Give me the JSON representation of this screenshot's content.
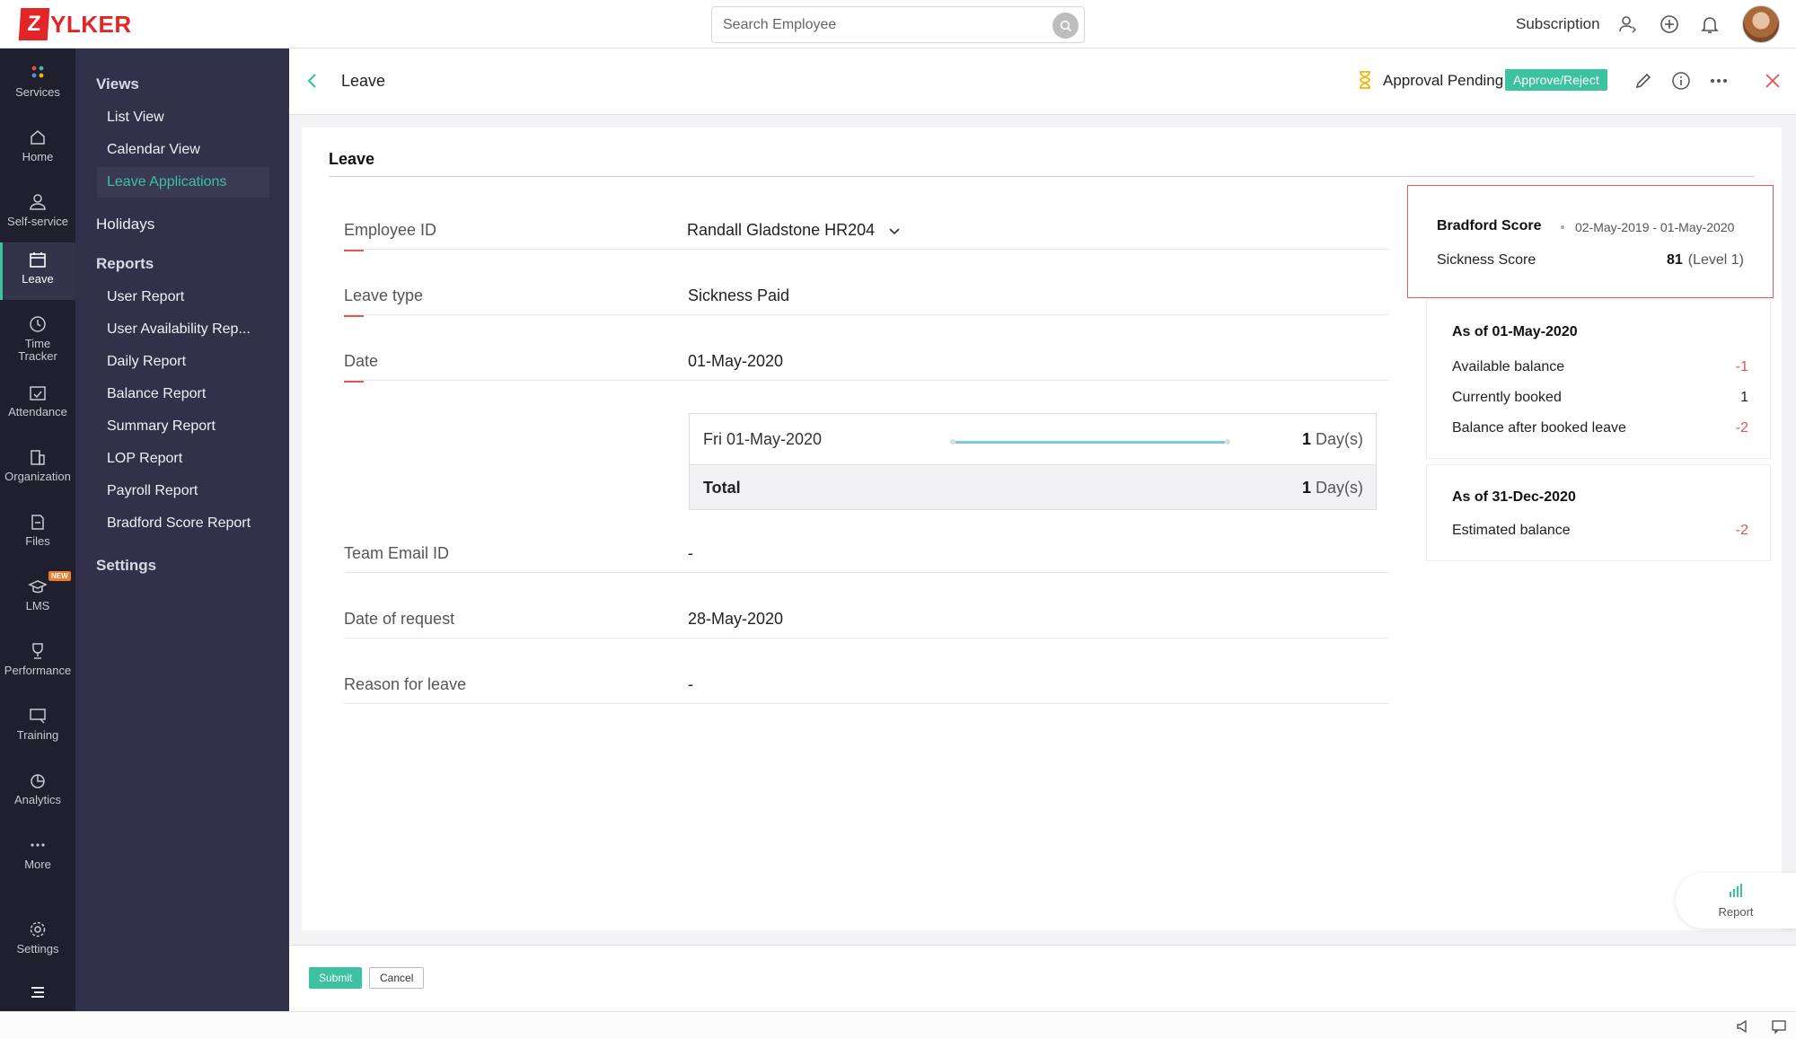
{
  "app": {
    "logo_letter": "Z",
    "logo_text": "YLKER",
    "search_placeholder": "Search Employee",
    "subscription_label": "Subscription"
  },
  "rail": [
    {
      "label": "Services",
      "icon": "services-icon"
    },
    {
      "label": "Home",
      "icon": "home-icon"
    },
    {
      "label": "Self-service",
      "icon": "person-icon"
    },
    {
      "label": "Leave",
      "icon": "calendar-icon",
      "active": true
    },
    {
      "label": "Time Tracker",
      "icon": "clock-icon"
    },
    {
      "label": "Attendance",
      "icon": "calendar-check-icon"
    },
    {
      "label": "Organization",
      "icon": "building-icon"
    },
    {
      "label": "Files",
      "icon": "files-icon"
    },
    {
      "label": "LMS",
      "icon": "graduation-cap-icon",
      "badge": "NEW"
    },
    {
      "label": "Performance",
      "icon": "trophy-icon"
    },
    {
      "label": "Training",
      "icon": "training-icon"
    },
    {
      "label": "Analytics",
      "icon": "pie-chart-icon"
    },
    {
      "label": "More",
      "icon": "more-icon"
    },
    {
      "label": "Settings",
      "icon": "gear-icon"
    }
  ],
  "subnav": {
    "views_heading": "Views",
    "views": [
      "List View",
      "Calendar View",
      "Leave Applications"
    ],
    "holidays": "Holidays",
    "reports_heading": "Reports",
    "reports": [
      "User Report",
      "User Availability Rep...",
      "Daily Report",
      "Balance Report",
      "Summary Report",
      "LOP Report",
      "Payroll Report",
      "Bradford Score Report"
    ],
    "settings": "Settings"
  },
  "header": {
    "title": "Leave",
    "status": "Approval Pending",
    "approve_label": "Approve/Reject"
  },
  "form": {
    "section_title": "Leave",
    "fields": [
      {
        "label": "Employee ID",
        "value": "Randall Gladstone HR204"
      },
      {
        "label": "Leave type",
        "value": "Sickness Paid"
      },
      {
        "label": "Date",
        "value": "01-May-2020"
      },
      {
        "label": "Team Email ID",
        "value": "-"
      },
      {
        "label": "Date of request",
        "value": "28-May-2020"
      },
      {
        "label": "Reason for leave",
        "value": "-"
      }
    ],
    "day_breakdown": {
      "date": "Fri 01-May-2020",
      "count": "1",
      "unit": "Day(s)",
      "total_label": "Total",
      "total_count": "1",
      "total_unit": "Day(s)"
    }
  },
  "bradford": {
    "title": "Bradford Score",
    "range": "02-May-2019 - 01-May-2020",
    "label": "Sickness Score",
    "score": "81",
    "level": "(Level 1)"
  },
  "balance_may": {
    "title": "As of 01-May-2020",
    "rows": [
      {
        "label": "Available balance",
        "value": "-1"
      },
      {
        "label": "Currently booked",
        "value": "1"
      },
      {
        "label": "Balance after booked leave",
        "value": "-2"
      }
    ]
  },
  "balance_dec": {
    "title": "As of 31-Dec-2020",
    "rows": [
      {
        "label": "Estimated balance",
        "value": "-2"
      }
    ]
  },
  "report_fab": "Report",
  "footer": {
    "submit": "Submit",
    "cancel": "Cancel"
  },
  "colors": {
    "accent": "#3cc2a0",
    "brand": "#e42527",
    "negative": "#e05555",
    "rail_bg": "#1f1f2e",
    "subnav_bg": "#31314a"
  }
}
